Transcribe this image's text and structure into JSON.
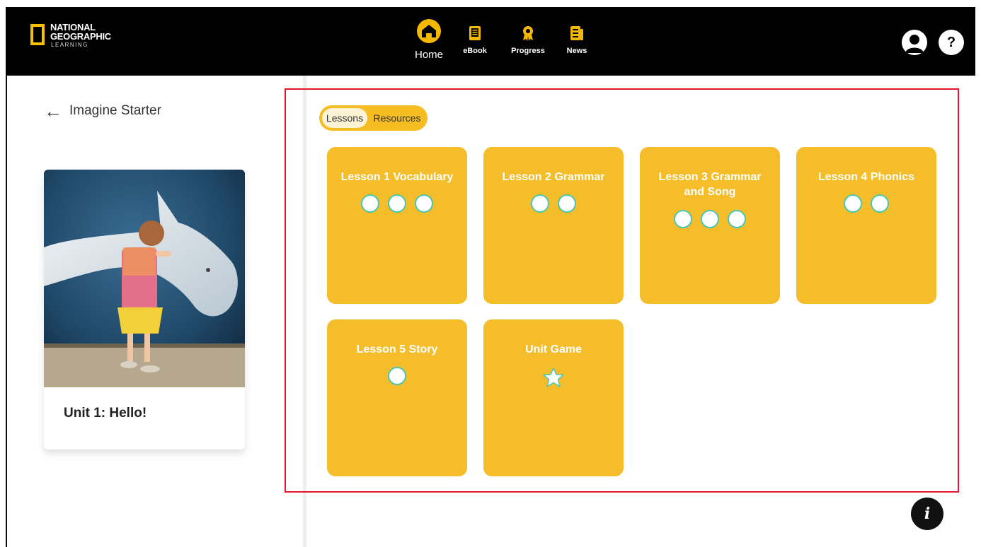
{
  "header": {
    "logo_line1": "NATIONAL",
    "logo_line2": "GEOGRAPHIC",
    "logo_sub": "LEARNING",
    "nav": [
      {
        "label": "Home",
        "icon": "home-icon",
        "active": true
      },
      {
        "label": "eBook",
        "icon": "ebook-icon"
      },
      {
        "label": "Progress",
        "icon": "award-icon"
      },
      {
        "label": "News",
        "icon": "news-icon"
      }
    ],
    "help_label": "?",
    "accent_color": "#f5b800"
  },
  "sidebar": {
    "back_label": "Imagine Starter",
    "unit_title": "Unit 1: Hello!"
  },
  "tabs": {
    "lessons": "Lessons",
    "resources": "Resources",
    "active": "Lessons"
  },
  "lessons": [
    {
      "title": "Lesson 1 Vocabulary",
      "activities": 3
    },
    {
      "title": "Lesson 2 Grammar",
      "activities": 2
    },
    {
      "title": "Lesson 3 Grammar and Song",
      "activities": 3
    },
    {
      "title": "Lesson 4 Phonics",
      "activities": 2
    },
    {
      "title": "Lesson 5 Story",
      "activities": 1
    },
    {
      "title": "Unit Game",
      "activities": 1,
      "icon": "star-icon"
    }
  ],
  "colors": {
    "card": "#f5bd2a",
    "dot_border": "#4bc7b3",
    "highlight": "#e3172b"
  },
  "info_label": "i"
}
